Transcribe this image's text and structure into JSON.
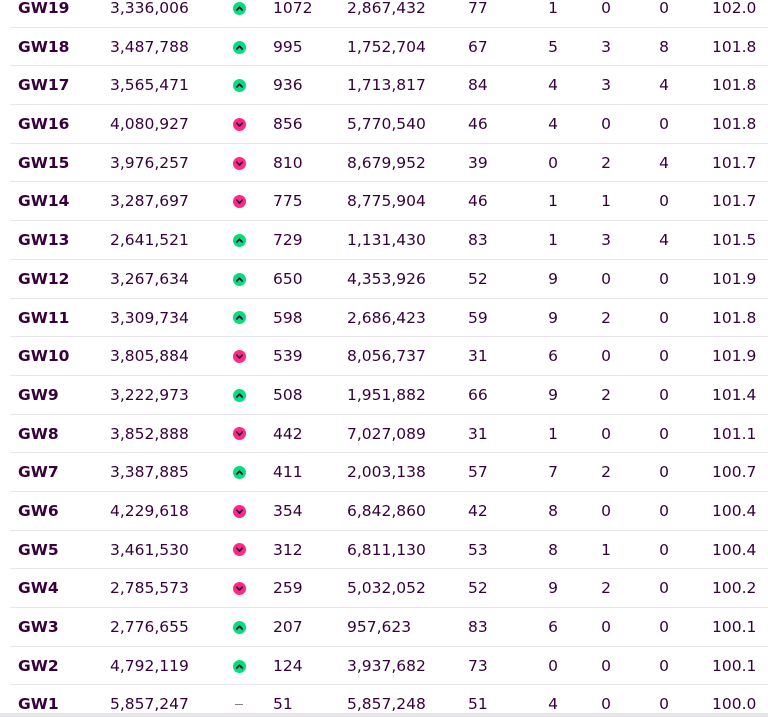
{
  "colors": {
    "text": "#37003c",
    "up": "#00e07a",
    "down": "#ff2882",
    "divider": "#e9e6ea"
  },
  "rows": [
    {
      "gw": "GW19",
      "points": "3,336,006",
      "movement": "up",
      "rank": "1072",
      "transfers": "2,867,432",
      "average": "77",
      "tr": "1",
      "tc": "0",
      "bench": "0",
      "value": "102.0"
    },
    {
      "gw": "GW18",
      "points": "3,487,788",
      "movement": "up",
      "rank": "995",
      "transfers": "1,752,704",
      "average": "67",
      "tr": "5",
      "tc": "3",
      "bench": "8",
      "value": "101.8"
    },
    {
      "gw": "GW17",
      "points": "3,565,471",
      "movement": "up",
      "rank": "936",
      "transfers": "1,713,817",
      "average": "84",
      "tr": "4",
      "tc": "3",
      "bench": "4",
      "value": "101.8"
    },
    {
      "gw": "GW16",
      "points": "4,080,927",
      "movement": "down",
      "rank": "856",
      "transfers": "5,770,540",
      "average": "46",
      "tr": "4",
      "tc": "0",
      "bench": "0",
      "value": "101.8"
    },
    {
      "gw": "GW15",
      "points": "3,976,257",
      "movement": "down",
      "rank": "810",
      "transfers": "8,679,952",
      "average": "39",
      "tr": "0",
      "tc": "2",
      "bench": "4",
      "value": "101.7"
    },
    {
      "gw": "GW14",
      "points": "3,287,697",
      "movement": "down",
      "rank": "775",
      "transfers": "8,775,904",
      "average": "46",
      "tr": "1",
      "tc": "1",
      "bench": "0",
      "value": "101.7"
    },
    {
      "gw": "GW13",
      "points": "2,641,521",
      "movement": "up",
      "rank": "729",
      "transfers": "1,131,430",
      "average": "83",
      "tr": "1",
      "tc": "3",
      "bench": "4",
      "value": "101.5"
    },
    {
      "gw": "GW12",
      "points": "3,267,634",
      "movement": "up",
      "rank": "650",
      "transfers": "4,353,926",
      "average": "52",
      "tr": "9",
      "tc": "0",
      "bench": "0",
      "value": "101.9"
    },
    {
      "gw": "GW11",
      "points": "3,309,734",
      "movement": "up",
      "rank": "598",
      "transfers": "2,686,423",
      "average": "59",
      "tr": "9",
      "tc": "2",
      "bench": "0",
      "value": "101.8"
    },
    {
      "gw": "GW10",
      "points": "3,805,884",
      "movement": "down",
      "rank": "539",
      "transfers": "8,056,737",
      "average": "31",
      "tr": "6",
      "tc": "0",
      "bench": "0",
      "value": "101.9"
    },
    {
      "gw": "GW9",
      "points": "3,222,973",
      "movement": "up",
      "rank": "508",
      "transfers": "1,951,882",
      "average": "66",
      "tr": "9",
      "tc": "2",
      "bench": "0",
      "value": "101.4"
    },
    {
      "gw": "GW8",
      "points": "3,852,888",
      "movement": "down",
      "rank": "442",
      "transfers": "7,027,089",
      "average": "31",
      "tr": "1",
      "tc": "0",
      "bench": "0",
      "value": "101.1"
    },
    {
      "gw": "GW7",
      "points": "3,387,885",
      "movement": "up",
      "rank": "411",
      "transfers": "2,003,138",
      "average": "57",
      "tr": "7",
      "tc": "2",
      "bench": "0",
      "value": "100.7"
    },
    {
      "gw": "GW6",
      "points": "4,229,618",
      "movement": "down",
      "rank": "354",
      "transfers": "6,842,860",
      "average": "42",
      "tr": "8",
      "tc": "0",
      "bench": "0",
      "value": "100.4"
    },
    {
      "gw": "GW5",
      "points": "3,461,530",
      "movement": "down",
      "rank": "312",
      "transfers": "6,811,130",
      "average": "53",
      "tr": "8",
      "tc": "1",
      "bench": "0",
      "value": "100.4"
    },
    {
      "gw": "GW4",
      "points": "2,785,573",
      "movement": "down",
      "rank": "259",
      "transfers": "5,032,052",
      "average": "52",
      "tr": "9",
      "tc": "2",
      "bench": "0",
      "value": "100.2"
    },
    {
      "gw": "GW3",
      "points": "2,776,655",
      "movement": "up",
      "rank": "207",
      "transfers": "957,623",
      "average": "83",
      "tr": "6",
      "tc": "0",
      "bench": "0",
      "value": "100.1"
    },
    {
      "gw": "GW2",
      "points": "4,792,119",
      "movement": "up",
      "rank": "124",
      "transfers": "3,937,682",
      "average": "73",
      "tr": "0",
      "tc": "0",
      "bench": "0",
      "value": "100.1"
    },
    {
      "gw": "GW1",
      "points": "5,857,247",
      "movement": "none",
      "rank": "51",
      "transfers": "5,857,248",
      "average": "51",
      "tr": "4",
      "tc": "0",
      "bench": "0",
      "value": "100.0"
    }
  ]
}
